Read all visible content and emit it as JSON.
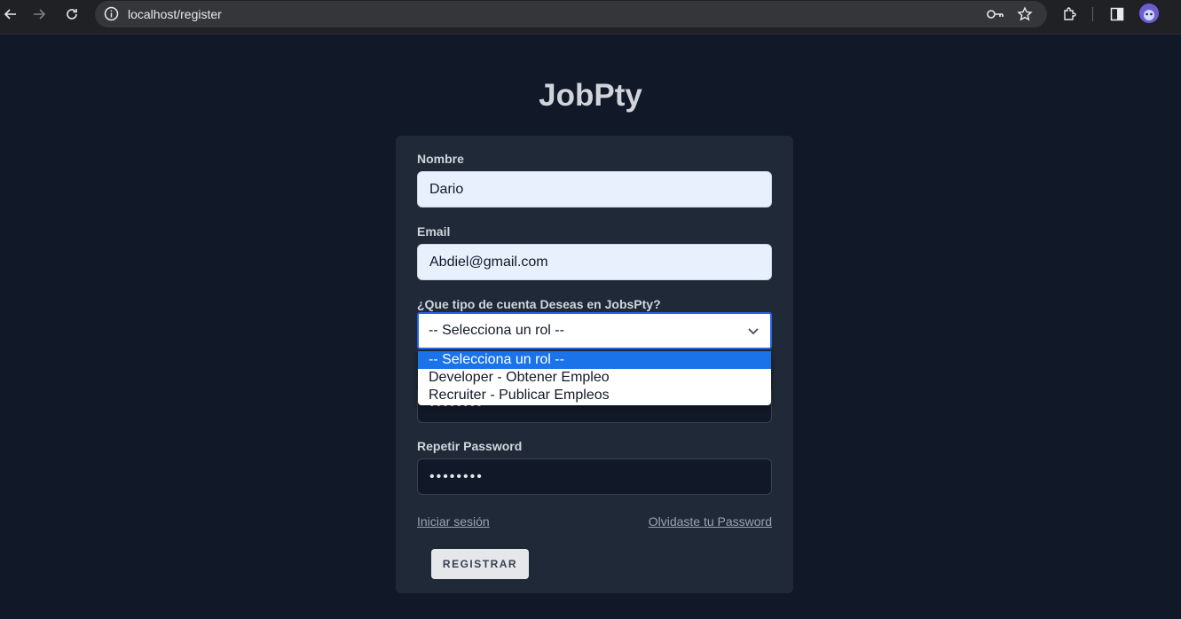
{
  "browser": {
    "url": "localhost/register"
  },
  "page": {
    "title": "JobPty"
  },
  "form": {
    "nombre_label": "Nombre",
    "nombre_value": "Dario",
    "email_label": "Email",
    "email_value": "Abdiel@gmail.com",
    "rol_label": "¿Que tipo de cuenta Deseas en JobsPty?",
    "rol_selected": "-- Selecciona un rol --",
    "rol_options": [
      "-- Selecciona un rol --",
      "Developer - Obtener Empleo",
      "Recruiter - Publicar Empleos"
    ],
    "password_value": "••••••••",
    "repetir_label": "Repetir Password",
    "repetir_value": "••••••••",
    "login_link": "Iniciar sesión",
    "forgot_link": "Olvidaste tu Password",
    "submit_label": "REGISTRAR"
  },
  "colors": {
    "background": "#111827",
    "card": "#1f2937",
    "accent": "#2563eb",
    "option_highlight": "#1a73e8"
  },
  "icons": [
    "back-icon",
    "forward-icon",
    "reload-icon",
    "info-icon",
    "key-icon",
    "star-icon",
    "extensions-icon",
    "side-panel-icon",
    "profile-avatar"
  ]
}
